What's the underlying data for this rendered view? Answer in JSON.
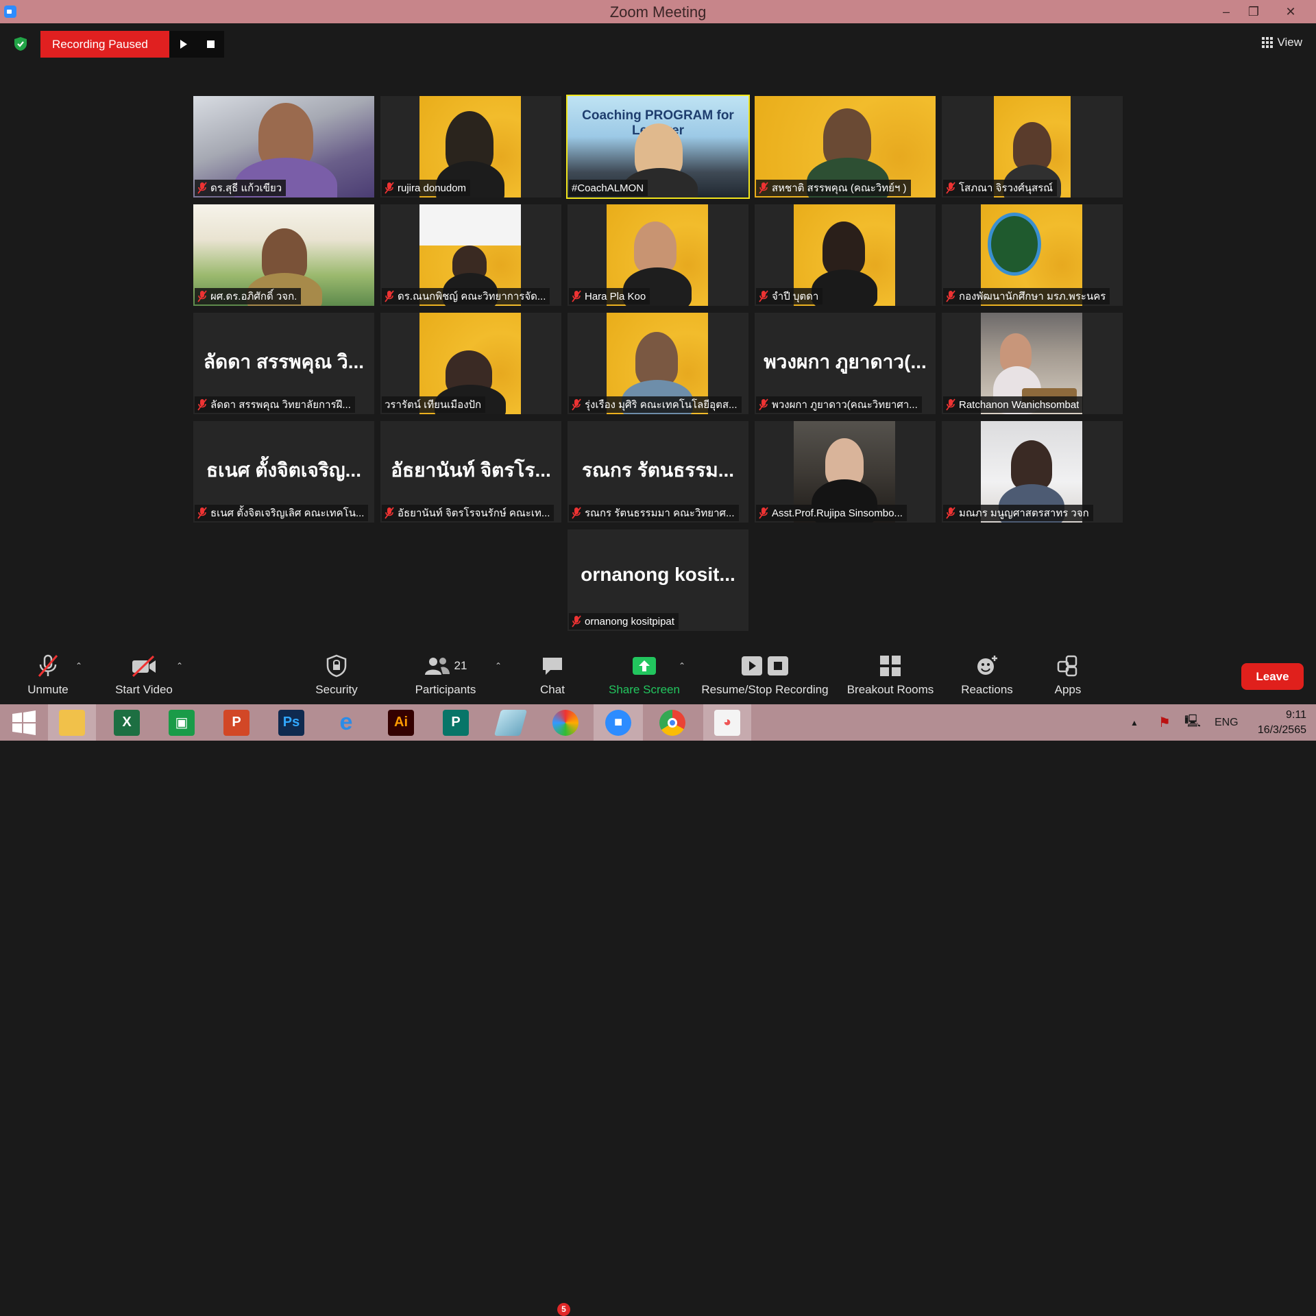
{
  "window": {
    "title": "Zoom Meeting"
  },
  "topbar": {
    "recording_status": "Recording Paused",
    "view_label": "View"
  },
  "participants": [
    {
      "name": "ดร.สุธี  แก้วเขียว",
      "video": "office"
    },
    {
      "name": "rujira donudom",
      "video": "poster"
    },
    {
      "name": "#CoachALMON",
      "video": "coach",
      "active_speaker": true,
      "screen_text": "Coaching PROGRAM for Lecturer"
    },
    {
      "name": "สหชาติ สรรพคุณ (คณะวิทย์ฯ )",
      "video": "poster-wide"
    },
    {
      "name": "โสภณา จิรวงศ์นุสรณ์",
      "video": "poster"
    },
    {
      "name": "ผศ.ดร.อภิศักดิ์ วจก.",
      "video": "temple"
    },
    {
      "name": "ดร.ณนกพิชญ์ คณะวิทยาการจัด...",
      "video": "poster"
    },
    {
      "name": "Hara Pla Koo",
      "video": "poster"
    },
    {
      "name": "จำปี บุตดา",
      "video": "poster"
    },
    {
      "name": "กองพัฒนานักศึกษา มรภ.พระนคร",
      "video": "poster-logo"
    },
    {
      "name": "ลัดดา สรรพคุณ วิทยาลัยการฝึ...",
      "display": "ลัดดา สรรพคุณ วิ..."
    },
    {
      "name": "วรารัตน์ เทียนเมืองปัก",
      "video": "poster"
    },
    {
      "name": "รุ่งเรือง มุศิริ คณะเทคโนโลยีอุตส...",
      "video": "poster"
    },
    {
      "name": "พวงผกา ภูยาดาว(คณะวิทยาศา...",
      "display": "พวงผกา ภูยาดาว(..."
    },
    {
      "name": "Ratchanon Wanichsombat",
      "video": "restaurant"
    },
    {
      "name": "ธเนศ ตั้งจิตเจริญเลิศ คณะเทคโน...",
      "display": "ธเนศ ตั้งจิตเจริญ..."
    },
    {
      "name": "อัธยานันท์ จิตรโรจนรักษ์ คณะเท...",
      "display": "อัธยานันท์ จิตรโร..."
    },
    {
      "name": "รณกร รัตนธรรมมา คณะวิทยาศ...",
      "display": "รณกร รัตนธรรม..."
    },
    {
      "name": "Asst.Prof.Rujipa Sinsombo...",
      "video": "dark"
    },
    {
      "name": "มณภร มนูญศาสตรสาทร วจก",
      "video": "white"
    },
    {
      "name": "ornanong kositpipat",
      "display": "ornanong kosit..."
    }
  ],
  "toolbar": {
    "unmute": "Unmute",
    "start_video": "Start Video",
    "security": "Security",
    "participants": "Participants",
    "participants_count": "21",
    "chat": "Chat",
    "chat_badge": "5",
    "share_screen": "Share Screen",
    "recording": "Resume/Stop Recording",
    "breakout": "Breakout Rooms",
    "reactions": "Reactions",
    "apps": "Apps",
    "leave": "Leave"
  },
  "taskbar": {
    "apps": [
      "start",
      "file-explorer",
      "excel",
      "sway",
      "powerpoint",
      "photoshop",
      "internet-explorer",
      "illustrator",
      "publisher",
      "eraser-app",
      "photoscape",
      "zoom",
      "chrome",
      "paint"
    ],
    "language": "ENG",
    "time": "9:11",
    "date": "16/3/2565"
  },
  "colors": {
    "accent_red": "#e02020",
    "active_speaker": "#f2e61c",
    "share_green": "#22c55e",
    "titlebar": "#c7858a",
    "taskbar": "#b38e93"
  }
}
